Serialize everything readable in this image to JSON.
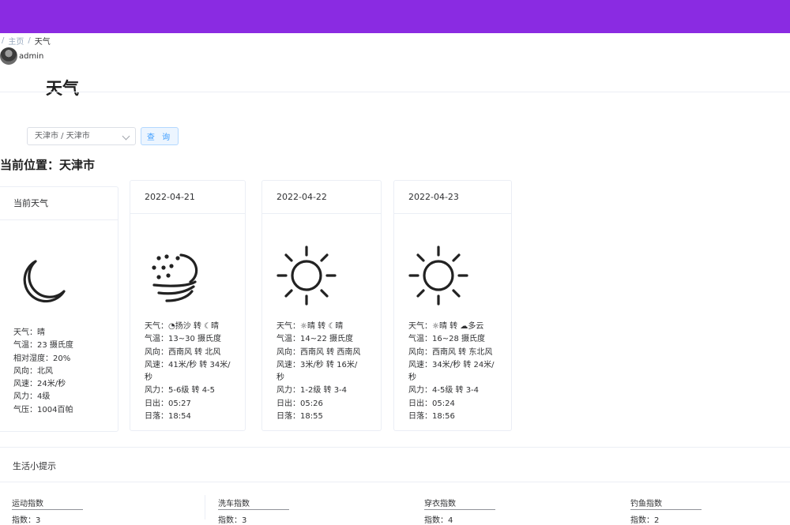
{
  "breadcrumb": {
    "sep": "/",
    "home": "主页",
    "current": "天气"
  },
  "user": {
    "name": "admin"
  },
  "page": {
    "title": "天气"
  },
  "search": {
    "city_value": "天津市 / 天津市",
    "query_label": "查 询"
  },
  "location": {
    "label": "当前位置：天津市"
  },
  "current_weather": {
    "header": "当前天气",
    "icon": "moon-icon",
    "lines": [
      "天气：晴",
      "气温：23 摄氏度",
      "相对湿度：20%",
      "风向：北风",
      "风速：24米/秒",
      "风力：4级",
      "气压：1004百帕"
    ]
  },
  "forecast": [
    {
      "date": "2022-04-21",
      "icon": "sandstorm-icon",
      "lines": [
        "天气：◔扬沙 转 ☾晴",
        "气温：13~30 摄氏度",
        "风向：西南风 转 北风",
        "风速：41米/秒 转 34米/\n秒",
        "风力：5-6级 转 4-5",
        "日出：05:27",
        "日落：18:54"
      ]
    },
    {
      "date": "2022-04-22",
      "icon": "sun-icon",
      "lines": [
        "天气：☼晴 转 ☾晴",
        "气温：14~22 摄氏度",
        "风向：西南风 转 西南风",
        "风速：3米/秒 转 16米/\n秒",
        "风力：1-2级 转 3-4",
        "日出：05:26",
        "日落：18:55"
      ]
    },
    {
      "date": "2022-04-23",
      "icon": "sun-icon",
      "lines": [
        "天气：☼晴 转 ☁多云",
        "气温：16~28 摄氏度",
        "风向：西南风 转 东北风",
        "风速：34米/秒 转 24米/\n秒",
        "风力：4-5级 转 3-4",
        "日出：05:24",
        "日落：18:56"
      ]
    }
  ],
  "tips": {
    "title": "生活小提示",
    "items": [
      {
        "name": "运动指数",
        "index": "指数：3"
      },
      {
        "name": "洗车指数",
        "index": "指数：3"
      },
      {
        "name": "穿衣指数",
        "index": "指数：4"
      },
      {
        "name": "钓鱼指数",
        "index": "指数：2"
      }
    ]
  }
}
